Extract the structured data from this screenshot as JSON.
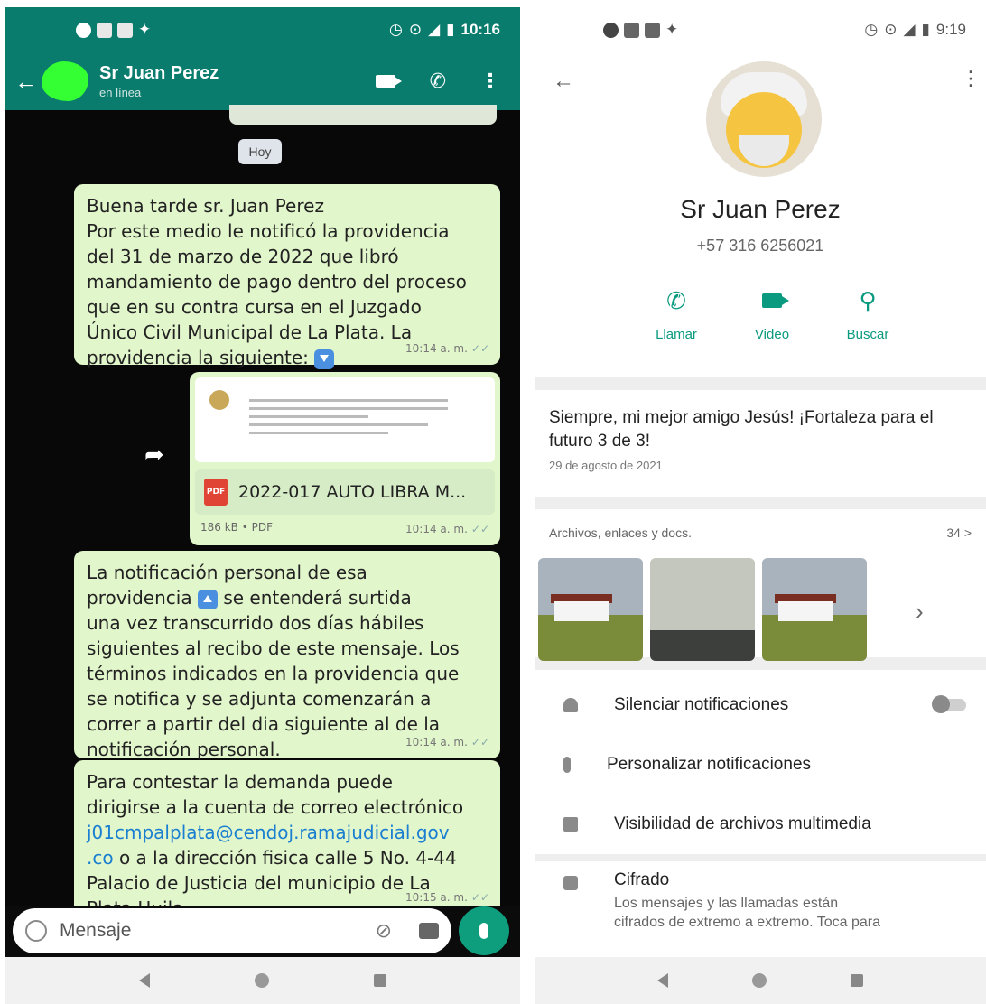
{
  "left": {
    "status": {
      "time": "10:16"
    },
    "header": {
      "title": "Sr Juan Perez",
      "subtitle": "en línea"
    },
    "date_chip": "Hoy",
    "messages": [
      {
        "lines": [
          "Buena tarde sr. Juan Perez",
          "Por este medio le notificó la providencia",
          "del 31 de marzo de 2022 que libró",
          "mandamiento de pago dentro del proceso",
          "que en su contra cursa en el Juzgado",
          "Único Civil Municipal de La Plata. La",
          "providencia la siguiente:"
        ],
        "time": "10:14 a. m."
      },
      {
        "doc_title": "2022-017 AUTO LIBRA M...",
        "size": "186 kB • PDF",
        "time": "10:14 a. m."
      },
      {
        "lines": [
          "La notificación personal de esa",
          "providencia",
          "se entenderá surtida",
          "una vez transcurrido dos días hábiles",
          "siguientes al recibo de este mensaje. Los",
          "términos indicados en la providencia que",
          "se notifica y se adjunta comenzarán a",
          "correr a partir del dia siguiente  al de la",
          "notificación personal."
        ],
        "time": "10:14 a. m."
      },
      {
        "lines": [
          "Para contestar la demanda puede",
          "dirigirse a la cuenta de correo electrónico",
          "j01cmpalplata@cendoj.ramajudicial.gov",
          ".co",
          "o a la dirección fisica calle 5 No. 4-44",
          "Palacio de Justicia del municipio de La",
          "Plata Huila."
        ],
        "time": "10:15 a. m."
      }
    ],
    "composer": {
      "placeholder": "Mensaje"
    }
  },
  "right": {
    "status": {
      "time": "9:19"
    },
    "contact": {
      "name": "Sr Juan Perez",
      "phone": "+57 316 6256021"
    },
    "actions": [
      {
        "label": "Llamar",
        "icon": "phone-icon"
      },
      {
        "label": "Video",
        "icon": "video-icon"
      },
      {
        "label": "Buscar",
        "icon": "search-icon"
      }
    ],
    "about": {
      "text": "Siempre, mi mejor amigo Jesús! ¡Fortaleza para el futuro 3 de 3!",
      "date": "29 de agosto de 2021"
    },
    "media": {
      "label": "Archivos, enlaces y docs.",
      "count": "34 >"
    },
    "settings": [
      {
        "label": "Silenciar notificaciones",
        "icon": "bell-icon",
        "toggle": false
      },
      {
        "label": "Personalizar notificaciones",
        "icon": "music-note-icon"
      },
      {
        "label": "Visibilidad de archivos multimedia",
        "icon": "image-icon"
      }
    ],
    "encryption": {
      "title": "Cifrado",
      "desc_1": "Los mensajes y las llamadas están",
      "desc_2": "cifrados de extremo a extremo. Toca para"
    }
  },
  "colors": {
    "whatsapp_green": "#0a7c6d",
    "bubble": "#e2f6cb",
    "accent": "#0a9a7f"
  }
}
